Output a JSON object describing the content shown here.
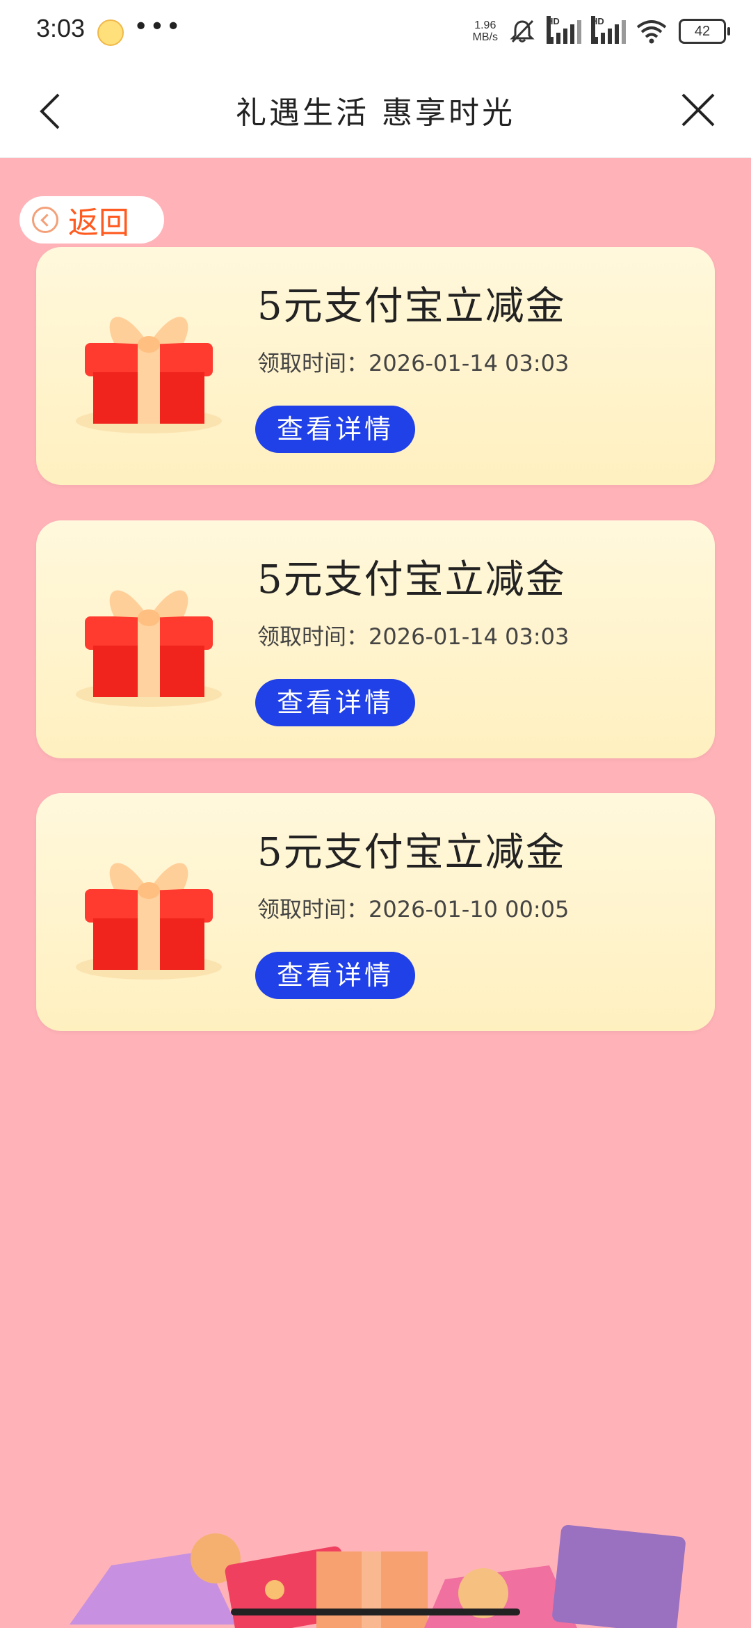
{
  "status_bar": {
    "time": "3:03",
    "menu_dots": "•••",
    "net_speed_value": "1.96",
    "net_speed_unit": "MB/s",
    "hd_label": "HD",
    "battery_level": "42"
  },
  "header": {
    "title": "礼遇生活 惠享时光"
  },
  "back_pill": {
    "label": "返回"
  },
  "cards": [
    {
      "title": "5元支付宝立减金",
      "time": "领取时间：2026-01-14 03:03",
      "button": "查看详情"
    },
    {
      "title": "5元支付宝立减金",
      "time": "领取时间：2026-01-14 03:03",
      "button": "查看详情"
    },
    {
      "title": "5元支付宝立减金",
      "time": "领取时间：2026-01-10 00:05",
      "button": "查看详情"
    }
  ],
  "colors": {
    "page_bg": "#ffb3b8",
    "card_bg": "#fff3cc",
    "button_blue": "#2040e8",
    "back_text": "#ff5a1f"
  }
}
